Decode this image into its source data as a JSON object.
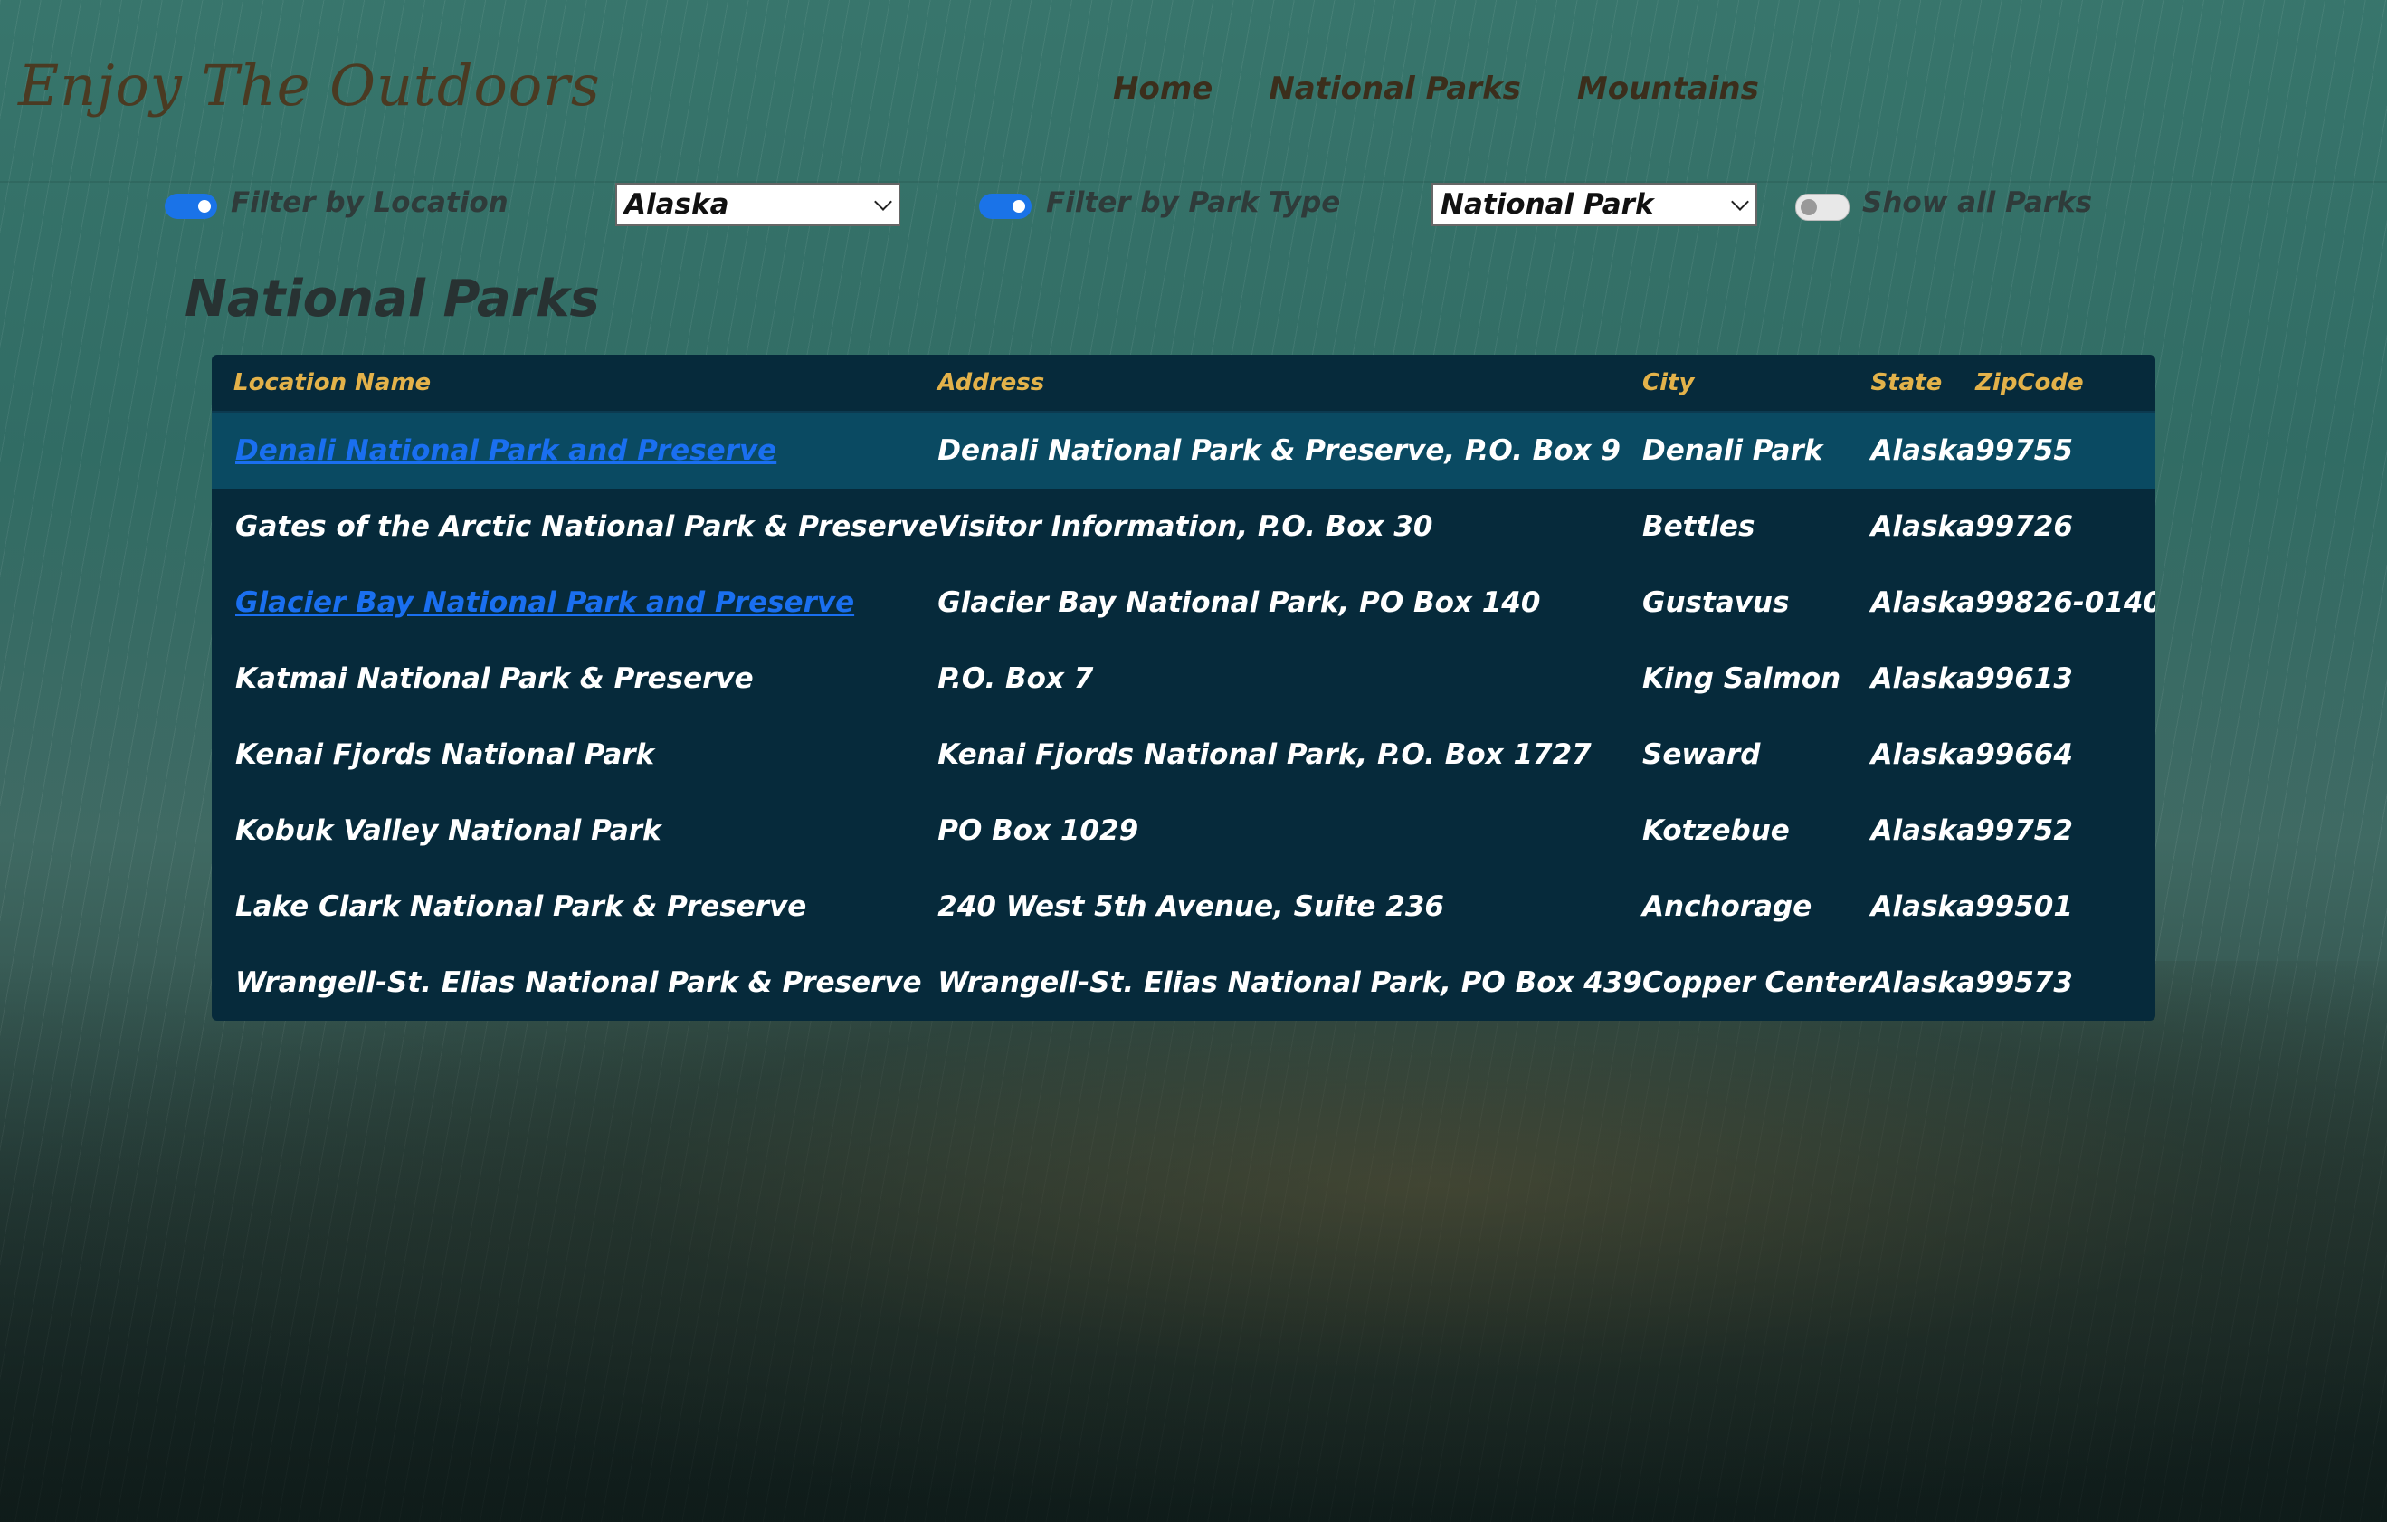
{
  "header": {
    "logo": "Enjoy The Outdoors",
    "nav": [
      "Home",
      "National Parks",
      "Mountains"
    ]
  },
  "filters": {
    "location_toggle_on": true,
    "location_label": "Filter by Location",
    "location_value": "Alaska",
    "type_toggle_on": true,
    "type_label": "Filter by Park Type",
    "type_value": "National Park",
    "showall_toggle_on": false,
    "showall_label": "Show all Parks"
  },
  "page_title": "National Parks",
  "table": {
    "columns": [
      "Location Name",
      "Address",
      "City",
      "State",
      "ZipCode"
    ],
    "rows": [
      {
        "name": "Denali National Park and Preserve",
        "address": "Denali National Park & Preserve, P.O. Box 9",
        "city": "Denali Park",
        "state": "Alaska",
        "zip": "99755",
        "link": true
      },
      {
        "name": "Gates of the Arctic National Park & Preserve",
        "address": "Visitor Information, P.O. Box 30",
        "city": "Bettles",
        "state": "Alaska",
        "zip": "99726",
        "link": false
      },
      {
        "name": "Glacier Bay National Park and Preserve",
        "address": "Glacier Bay National Park, PO Box 140",
        "city": "Gustavus",
        "state": "Alaska",
        "zip": "99826-0140",
        "link": true
      },
      {
        "name": "Katmai National Park & Preserve",
        "address": "P.O. Box 7",
        "city": "King Salmon",
        "state": "Alaska",
        "zip": "99613",
        "link": false
      },
      {
        "name": "Kenai Fjords National Park",
        "address": "Kenai Fjords National Park, P.O. Box 1727",
        "city": "Seward",
        "state": "Alaska",
        "zip": "99664",
        "link": false
      },
      {
        "name": "Kobuk Valley National Park",
        "address": "PO Box 1029",
        "city": "Kotzebue",
        "state": "Alaska",
        "zip": "99752",
        "link": false
      },
      {
        "name": "Lake Clark National Park & Preserve",
        "address": "240 West 5th Avenue, Suite 236",
        "city": "Anchorage",
        "state": "Alaska",
        "zip": "99501",
        "link": false
      },
      {
        "name": "Wrangell-St. Elias National Park & Preserve",
        "address": "Wrangell-St. Elias National Park, PO Box 439",
        "city": "Copper Center",
        "state": "Alaska",
        "zip": "99573",
        "link": false
      }
    ]
  },
  "colors": {
    "header_text": "#e3b24a",
    "table_bg": "#062a3b",
    "link": "#1a6ff0",
    "toggle_on": "#1a73e8"
  }
}
